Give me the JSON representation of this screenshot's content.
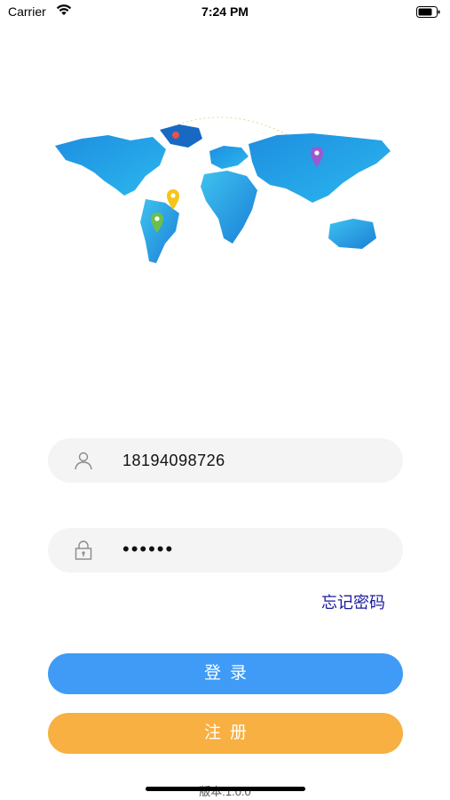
{
  "status_bar": {
    "carrier": "Carrier",
    "time": "7:24 PM"
  },
  "map": {
    "pins": [
      {
        "name": "pin-russia",
        "color": "#e8524a"
      },
      {
        "name": "pin-asia",
        "color": "#9b59d0"
      },
      {
        "name": "pin-north-south-america",
        "color": "#f5c518"
      },
      {
        "name": "pin-south-america",
        "color": "#6cc04a"
      }
    ]
  },
  "login_form": {
    "username_icon": "user-icon",
    "username_value": "18194098726",
    "password_icon": "lock-icon",
    "password_value": "••••••",
    "forgot_password_label": "忘记密码",
    "login_label": "登录",
    "register_label": "注册"
  },
  "footer": {
    "version_text": "版本:1.0.0"
  },
  "colors": {
    "login_button": "#3f9bf6",
    "register_button": "#f7b041",
    "forgot_link": "#1a1aa0",
    "field_background": "#f4f4f4"
  }
}
